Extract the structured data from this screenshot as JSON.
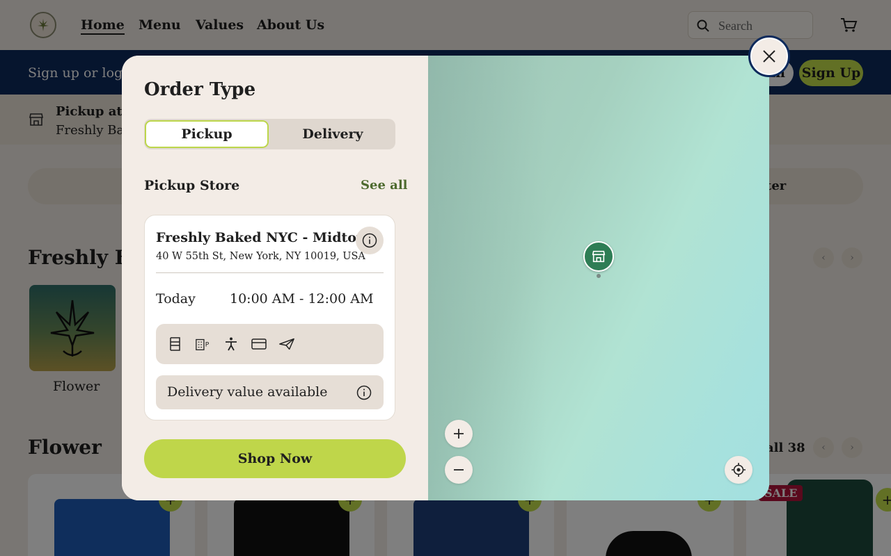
{
  "nav": {
    "items": [
      {
        "label": "Home",
        "active": true
      },
      {
        "label": "Menu",
        "active": false
      },
      {
        "label": "Values",
        "active": false
      },
      {
        "label": "About Us",
        "active": false
      }
    ],
    "search_placeholder": "Search",
    "logo_icon": "cannabis-leaf-icon",
    "cart_icon": "cart-icon"
  },
  "banner": {
    "text": "Sign up or log in",
    "login_label": "in",
    "signup_label": "Sign Up"
  },
  "pickup_bar": {
    "label": "Pickup at",
    "store_name": "Freshly Bak"
  },
  "filter_bar": {
    "label": "ter"
  },
  "sections": {
    "freshly_baked": {
      "title": "Freshly Ba"
    },
    "category": {
      "label": "Flower"
    },
    "flower": {
      "title": "Flower",
      "see_all": "all 38"
    }
  },
  "products": {
    "sale_badge": "SALE",
    "plus_label": "+"
  },
  "modal": {
    "title": "Order Type",
    "order_types": [
      {
        "label": "Pickup",
        "selected": true
      },
      {
        "label": "Delivery",
        "selected": false
      }
    ],
    "pickup_store_label": "Pickup Store",
    "see_all_label": "See all",
    "store": {
      "name": "Freshly Baked NYC - Midtown",
      "address": "40 W 55th St, New York, NY 10019, USA",
      "day": "Today",
      "hours": "10:00 AM - 12:00 AM",
      "amenity_icons": [
        "menu-board-icon",
        "parking-icon",
        "accessibility-icon",
        "credit-card-icon",
        "send-icon"
      ],
      "delivery_value_text": "Delivery value available"
    },
    "shop_now_label": "Shop Now",
    "map": {
      "pin_icon": "store-icon",
      "zoom_in_icon": "plus-icon",
      "zoom_out_icon": "minus-icon",
      "locate_icon": "locate-icon"
    },
    "close_icon": "close-icon"
  },
  "colors": {
    "background": "#f3ede6",
    "banner": "#0d2a5c",
    "accent_green": "#bfd64a",
    "map_pin": "#2e7d55",
    "sale_red": "#b3123a"
  }
}
